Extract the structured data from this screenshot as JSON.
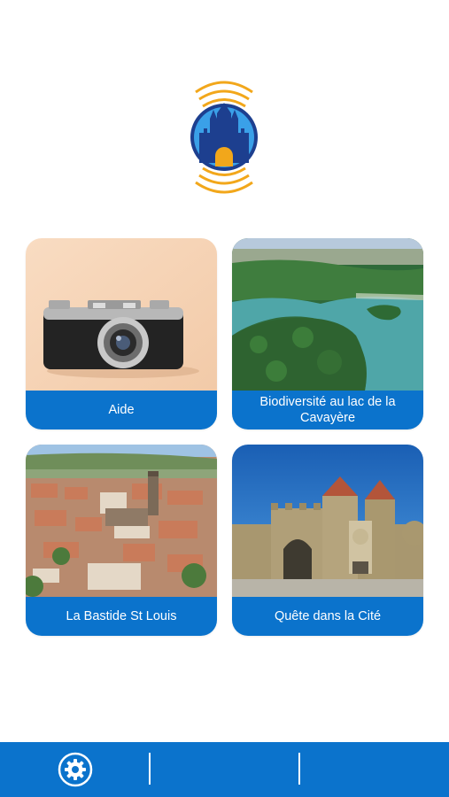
{
  "logo": {
    "icon": "castle-signal-logo",
    "colors": {
      "blue": "#1d3f8f",
      "orange": "#f2a71b",
      "sky": "#3aa0e8"
    }
  },
  "cards": [
    {
      "label": "Aide",
      "image": "vintage-camera-photo"
    },
    {
      "label": "Biodiversité au lac de la Cavayère",
      "image": "lake-aerial-photo"
    },
    {
      "label": "La Bastide St Louis",
      "image": "town-aerial-photo"
    },
    {
      "label": "Quête dans la Cité",
      "image": "castle-gate-photo"
    }
  ],
  "bottom_nav": {
    "settings_icon": "gear-icon"
  },
  "colors": {
    "accent": "#0b73cc",
    "background": "#ffffff"
  }
}
